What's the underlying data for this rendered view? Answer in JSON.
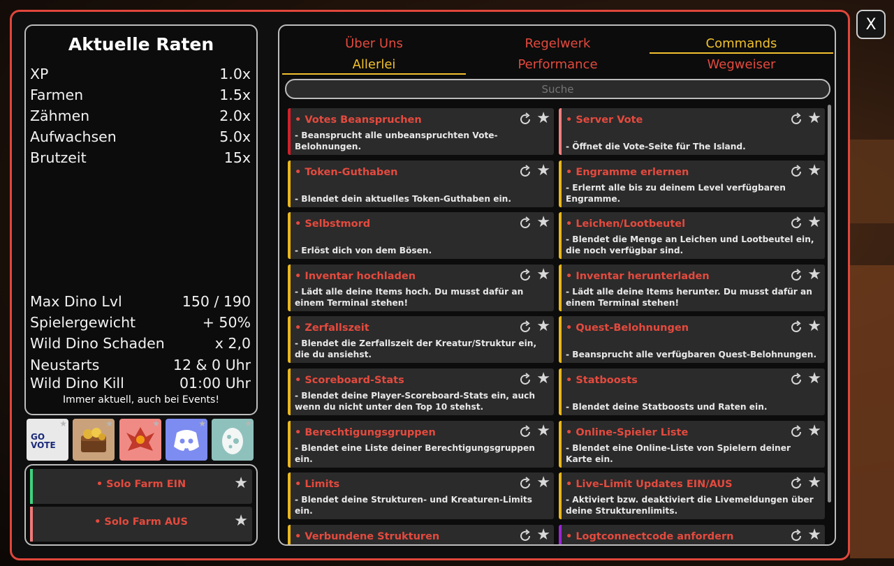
{
  "close_label": "X",
  "rates": {
    "title": "Aktuelle Raten",
    "top": [
      {
        "label": "XP",
        "value": "1.0x"
      },
      {
        "label": "Farmen",
        "value": "1.5x"
      },
      {
        "label": "Zähmen",
        "value": "2.0x"
      },
      {
        "label": "Aufwachsen",
        "value": "5.0x"
      },
      {
        "label": "Brutzeit",
        "value": "15x"
      }
    ],
    "bottom": [
      {
        "label": "Max Dino Lvl",
        "value": "150 / 190"
      },
      {
        "label": "Spielergewicht",
        "value": "+ 50%"
      },
      {
        "label": "Wild Dino Schaden",
        "value": "x 2,0"
      },
      {
        "label": "Neustarts",
        "value": "12 & 0 Uhr"
      },
      {
        "label": "Wild Dino Kill",
        "value": "01:00 Uhr"
      }
    ],
    "note": "Immer aktuell, auch bei Events!"
  },
  "shortcuts": [
    {
      "name": "go-vote",
      "label": "GO VOTE",
      "bg": "#e9e9e9"
    },
    {
      "name": "treasure",
      "label": "",
      "bg": "#c9a27c"
    },
    {
      "name": "phoenix",
      "label": "",
      "bg": "#f08a84"
    },
    {
      "name": "discord",
      "label": "",
      "bg": "#7d8cf0"
    },
    {
      "name": "egg",
      "label": "",
      "bg": "#8fc1bc"
    }
  ],
  "solo": [
    {
      "title": "• Solo Farm EIN",
      "color": "#3fd27f"
    },
    {
      "title": "• Solo Farm AUS",
      "color": "#f07a7a"
    }
  ],
  "tabs": [
    {
      "label": "Über Uns",
      "active": false
    },
    {
      "label": "Regelwerk",
      "active": false
    },
    {
      "label": "Commands",
      "active": true
    },
    {
      "label": "Allerlei",
      "active": true
    },
    {
      "label": "Performance",
      "active": false
    },
    {
      "label": "Wegweiser",
      "active": false
    }
  ],
  "search": {
    "placeholder": "Suche"
  },
  "colors": {
    "accent_red": "#e44a3e",
    "accent_yellow": "#f2c12e",
    "bar_red": "#d61f2a",
    "bar_pink": "#f08080",
    "bar_yellow": "#eab71b",
    "bar_purple": "#9b27d6"
  },
  "commands_left": [
    {
      "name": "• Votes Beanspruchen",
      "desc": "- Beansprucht alle unbeanspruchten Vote-Belohnungen.",
      "color": "#d61f2a"
    },
    {
      "name": "• Token-Guthaben",
      "desc": "- Blendet dein aktuelles Token-Guthaben ein.",
      "color": "#eab71b"
    },
    {
      "name": "• Selbstmord",
      "desc": "- Erlöst dich von dem Bösen.",
      "color": "#eab71b"
    },
    {
      "name": "• Inventar hochladen",
      "desc": "- Lädt alle deine Items hoch. Du musst dafür an einem Terminal stehen!",
      "color": "#eab71b"
    },
    {
      "name": "• Zerfallszeit",
      "desc": "- Blendet die Zerfallszeit der Kreatur/Struktur ein, die du ansiehst.",
      "color": "#eab71b"
    },
    {
      "name": "• Scoreboard-Stats",
      "desc": "- Blendet deine Player-Scoreboard-Stats ein, auch wenn du nicht unter den Top 10 stehst.",
      "color": "#eab71b"
    },
    {
      "name": "• Berechtigungsgruppen",
      "desc": "- Blendet eine Liste deiner Berechtigungsgruppen ein.",
      "color": "#eab71b"
    },
    {
      "name": "• Limits",
      "desc": "- Blendet deine Strukturen- und Kreaturen-Limits ein.",
      "color": "#eab71b"
    },
    {
      "name": "• Verbundene Strukturen",
      "desc": "",
      "color": "#eab71b"
    }
  ],
  "commands_right": [
    {
      "name": "• Server Vote",
      "desc": "- Öffnet die Vote-Seite für The Island.",
      "color": "#f08080"
    },
    {
      "name": "• Engramme erlernen",
      "desc": "- Erlernt alle bis zu deinem Level verfügbaren Engramme.",
      "color": "#eab71b"
    },
    {
      "name": "• Leichen/Lootbeutel",
      "desc": "- Blendet die Menge an Leichen und Lootbeutel ein, die noch verfügbar sind.",
      "color": "#eab71b"
    },
    {
      "name": "• Inventar herunterladen",
      "desc": "- Lädt alle deine Items herunter. Du musst dafür an einem Terminal stehen!",
      "color": "#eab71b"
    },
    {
      "name": "• Quest-Belohnungen",
      "desc": "- Beansprucht alle verfügbaren Quest-Belohnungen.",
      "color": "#eab71b"
    },
    {
      "name": "• Statboosts",
      "desc": "- Blendet deine Statboosts und Raten ein.",
      "color": "#eab71b"
    },
    {
      "name": "• Online-Spieler Liste",
      "desc": "- Blendet eine Online-Liste von Spielern deiner Karte ein.",
      "color": "#eab71b"
    },
    {
      "name": "• Live-Limit Updates EIN/AUS",
      "desc": "- Aktiviert bzw. deaktiviert die Livemeldungen über deine Strukturenlimits.",
      "color": "#eab71b"
    },
    {
      "name": "• Logtconnectcode anfordern",
      "desc": "",
      "color": "#9b27d6"
    }
  ]
}
